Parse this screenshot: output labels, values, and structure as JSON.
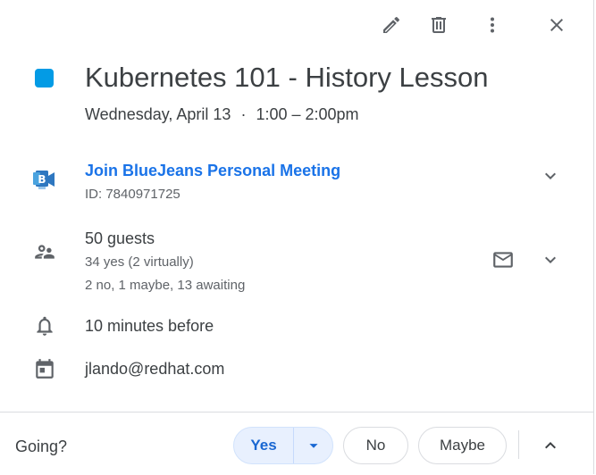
{
  "toolbar": {
    "edit_icon": "pencil-icon",
    "delete_icon": "trash-icon",
    "more_icon": "more-vert-icon",
    "close_icon": "close-icon"
  },
  "event": {
    "color": "#039be5",
    "title": "Kubernetes 101 - History Lesson",
    "date": "Wednesday, April 13",
    "separator": "·",
    "time": "1:00 – 2:00pm"
  },
  "conference": {
    "icon": "bluejeans-logo",
    "link_label": "Join BlueJeans Personal Meeting",
    "id_text": "ID: 7840971725"
  },
  "guests": {
    "count_label": "50 guests",
    "yes_summary": "34 yes (2 virtually)",
    "other_summary": "2 no, 1 maybe, 13 awaiting"
  },
  "reminder": {
    "label": "10 minutes before"
  },
  "calendar": {
    "owner": "jlando@redhat.com"
  },
  "rsvp": {
    "prompt": "Going?",
    "yes_label": "Yes",
    "no_label": "No",
    "maybe_label": "Maybe",
    "selected": "Yes"
  },
  "colors": {
    "accent": "#1a73e8",
    "selected_bg": "#e8f0fe"
  }
}
